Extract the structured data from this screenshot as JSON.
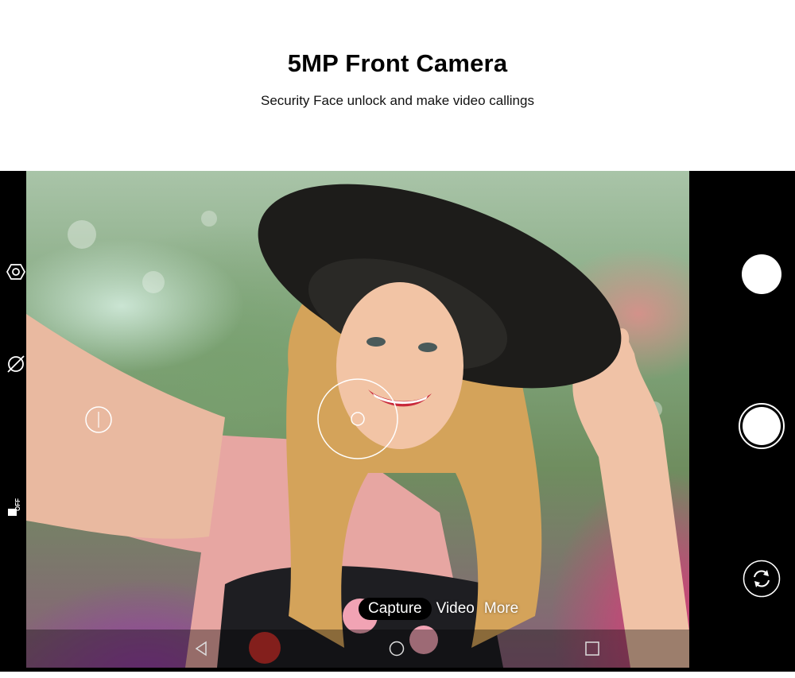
{
  "header": {
    "title": "5MP Front Camera",
    "subtitle": "Security Face unlock and make video callings"
  },
  "camera": {
    "modes": {
      "active": "Capture",
      "video": "Video",
      "more": "More"
    },
    "left_toolbar": [
      "settings-icon",
      "filter-off-icon",
      "hdr-off-icon"
    ],
    "left_toolbar_labels": {
      "hdr": "OFF"
    },
    "right_controls": [
      "white-circle-button",
      "shutter-button",
      "switch-camera-icon"
    ],
    "nav": [
      "back-icon",
      "home-icon",
      "recents-icon"
    ],
    "colors": {
      "pill": "#000000",
      "text": "#ffffff",
      "frame": "#000000"
    }
  }
}
